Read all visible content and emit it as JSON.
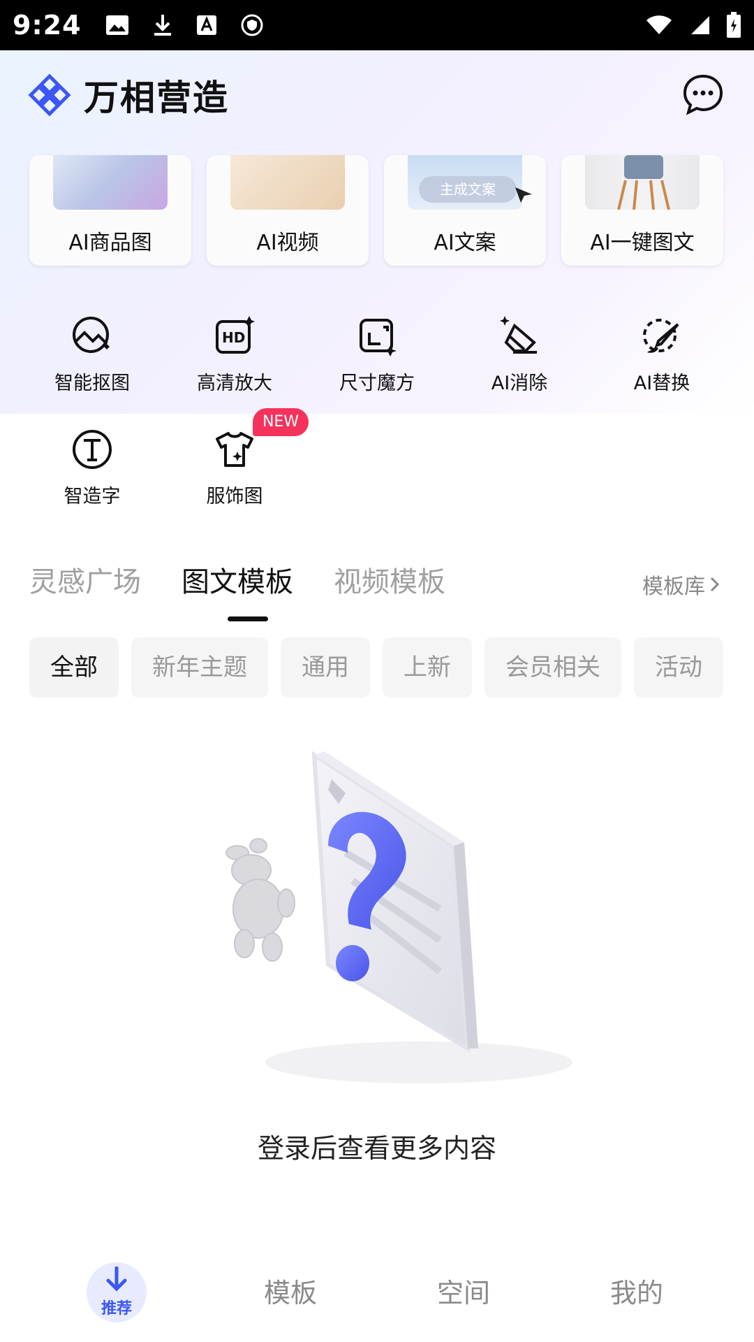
{
  "status_bar": {
    "time": "9:24"
  },
  "header": {
    "app_name": "万相营造"
  },
  "ai_cards": [
    {
      "label": "AI商品图"
    },
    {
      "label": "AI视频"
    },
    {
      "label": "AI文案",
      "overlay": "主成文案"
    },
    {
      "label": "AI一键图文"
    }
  ],
  "tools": [
    {
      "label": "智能抠图",
      "icon": "cutout-icon"
    },
    {
      "label": "高清放大",
      "icon": "hd-icon"
    },
    {
      "label": "尺寸魔方",
      "icon": "resize-icon"
    },
    {
      "label": "AI消除",
      "icon": "eraser-icon"
    },
    {
      "label": "AI替换",
      "icon": "brush-replace-icon"
    },
    {
      "label": "智造字",
      "icon": "text-icon"
    },
    {
      "label": "服饰图",
      "icon": "tshirt-icon",
      "badge": "NEW"
    }
  ],
  "tabs": [
    {
      "label": "灵感广场"
    },
    {
      "label": "图文模板",
      "active": true
    },
    {
      "label": "视频模板"
    }
  ],
  "template_library": "模板库",
  "chips": [
    {
      "label": "全部",
      "active": true
    },
    {
      "label": "新年主题"
    },
    {
      "label": "通用"
    },
    {
      "label": "上新"
    },
    {
      "label": "会员相关"
    },
    {
      "label": "活动"
    }
  ],
  "empty_state": {
    "text": "登录后查看更多内容"
  },
  "bottom_nav": [
    {
      "label": "推荐",
      "active": true
    },
    {
      "label": "模板"
    },
    {
      "label": "空间"
    },
    {
      "label": "我的"
    }
  ],
  "colors": {
    "accent": "#3b57f5",
    "badge": "#f5325b"
  }
}
